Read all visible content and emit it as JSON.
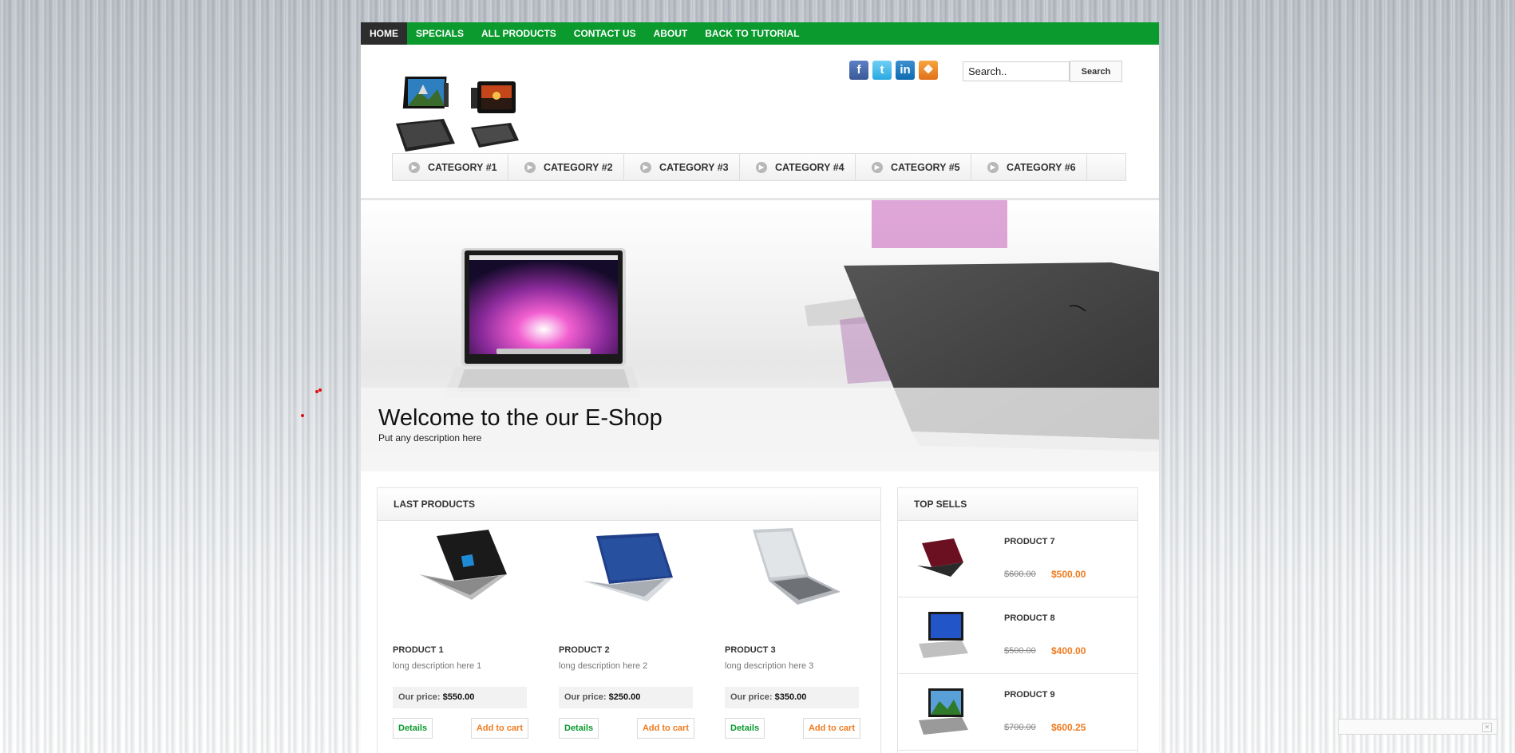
{
  "nav": {
    "items": [
      {
        "label": "HOME",
        "active": true
      },
      {
        "label": "SPECIALS"
      },
      {
        "label": "ALL PRODUCTS"
      },
      {
        "label": "CONTACT US"
      },
      {
        "label": "ABOUT"
      },
      {
        "label": "BACK TO TUTORIAL"
      }
    ]
  },
  "social": {
    "icons": [
      "facebook-icon",
      "twitter-icon",
      "linkedin-icon",
      "rss-icon"
    ]
  },
  "search": {
    "value": "Search..",
    "button": "Search"
  },
  "categories": [
    "CATEGORY #1",
    "CATEGORY #2",
    "CATEGORY #3",
    "CATEGORY #4",
    "CATEGORY #5",
    "CATEGORY #6"
  ],
  "hero": {
    "title": "Welcome to the our E-Shop",
    "description": "Put any description here"
  },
  "last_products": {
    "heading": "LAST PRODUCTS",
    "price_label": "Our price:",
    "details_label": "Details",
    "cart_label": "Add to cart",
    "items": [
      {
        "name": "PRODUCT 1",
        "description": "long description here 1",
        "price": "$550.00",
        "color": "#1a1a1a"
      },
      {
        "name": "PRODUCT 2",
        "description": "long description here 2",
        "price": "$250.00",
        "color": "#1f3f8a"
      },
      {
        "name": "PRODUCT 3",
        "description": "long description here 3",
        "price": "$350.00",
        "color": "#c8ccd0"
      }
    ]
  },
  "top_sells": {
    "heading": "TOP SELLS",
    "items": [
      {
        "name": "PRODUCT 7",
        "old_price": "$600.00",
        "price": "$500.00",
        "color": "#6a1020"
      },
      {
        "name": "PRODUCT 8",
        "old_price": "$500.00",
        "price": "$400.00",
        "color": "#2255c8"
      },
      {
        "name": "PRODUCT 9",
        "old_price": "$700.00",
        "price": "$600.25",
        "color": "#2f7a2a"
      }
    ]
  },
  "colors": {
    "nav_green": "#0a9a2e",
    "accent_orange": "#f07a1e",
    "nav_active": "#2d2d2d"
  }
}
